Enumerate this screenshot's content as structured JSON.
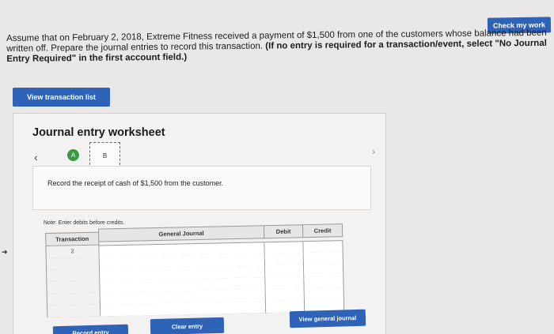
{
  "header": {
    "check_label": "Check my work"
  },
  "question": {
    "text": "Assume that on February 2, 2018, Extreme Fitness received a payment of $1,500 from one of the customers whose balance had been written off. Prepare the journal entries to record this transaction.",
    "instruction": "(If no entry is required for a transaction/event, select \"No Journal Entry Required\" in the first account field.)"
  },
  "toolbar": {
    "view_transactions_label": "View transaction list"
  },
  "worksheet": {
    "title": "Journal entry worksheet",
    "tabs": [
      "A",
      "B"
    ],
    "record_text": "Record the receipt of cash of $1,500 from the customer.",
    "note": "Note: Enter debits before credits.",
    "table": {
      "headers": [
        "Transaction",
        "General Journal",
        "Debit",
        "Credit"
      ],
      "rows": [
        {
          "transaction": "2",
          "account": "",
          "debit": "",
          "credit": ""
        },
        {
          "transaction": "",
          "account": "",
          "debit": "",
          "credit": ""
        },
        {
          "transaction": "",
          "account": "",
          "debit": "",
          "credit": ""
        },
        {
          "transaction": "",
          "account": "",
          "debit": "",
          "credit": ""
        },
        {
          "transaction": "",
          "account": "",
          "debit": "",
          "credit": ""
        },
        {
          "transaction": "",
          "account": "",
          "debit": "",
          "credit": ""
        }
      ]
    },
    "buttons": {
      "record_label": "Record entry",
      "clear_label": "Clear entry",
      "view_general_journal_label": "View general journal"
    }
  },
  "colors": {
    "accent": "#2e63b8",
    "tab_done": "#3a9a45"
  },
  "icons": [
    "chevron-left-icon",
    "chevron-right-icon"
  ]
}
